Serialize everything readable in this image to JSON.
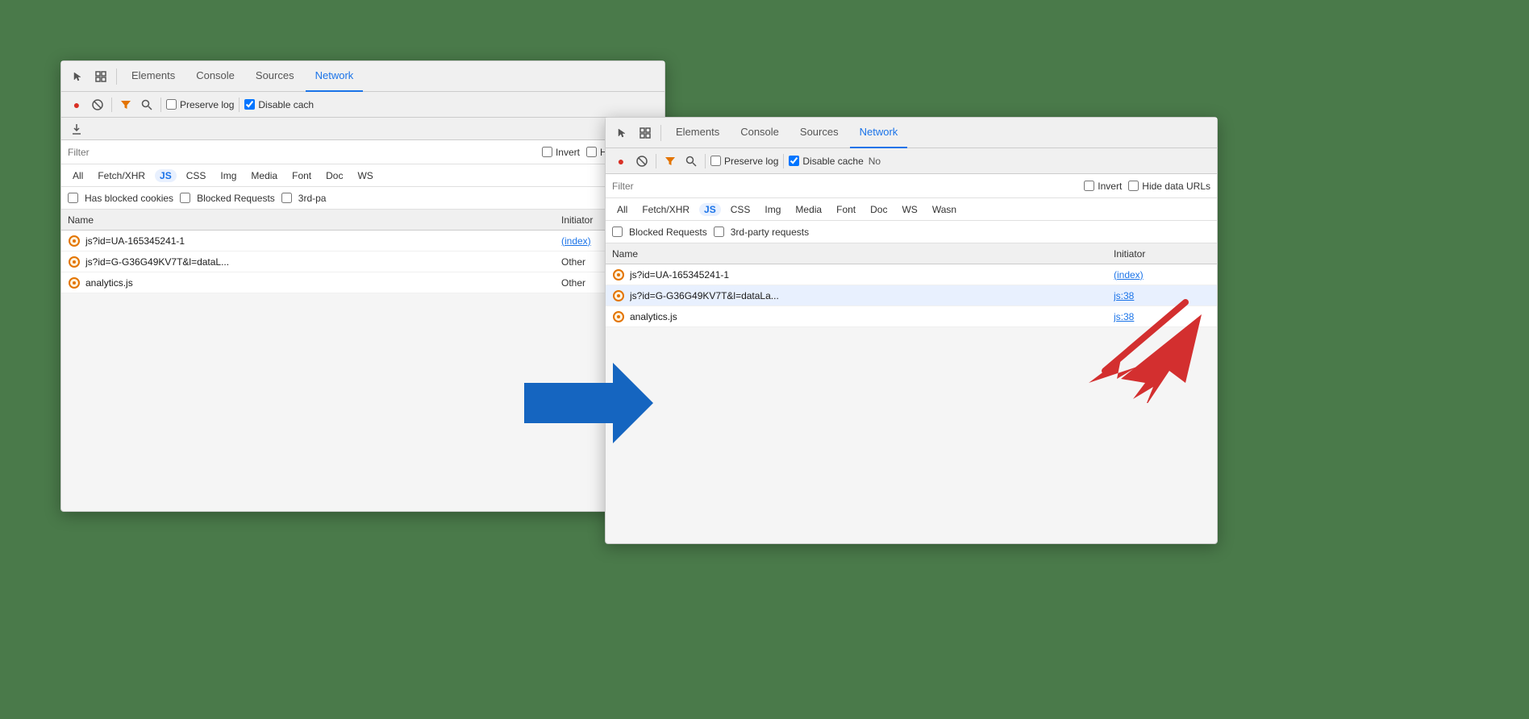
{
  "colors": {
    "background": "#4a7a4a",
    "active_tab": "#1a73e8",
    "record_red": "#d93025",
    "filter_orange": "#e37400",
    "blue_arrow": "#1565c0",
    "red_arrow": "#d32f2f"
  },
  "window1": {
    "tabs": [
      {
        "id": "elements",
        "label": "Elements",
        "active": false
      },
      {
        "id": "console",
        "label": "Console",
        "active": false
      },
      {
        "id": "sources",
        "label": "Sources",
        "active": false
      },
      {
        "id": "network",
        "label": "Network",
        "active": true
      }
    ],
    "toolbar": {
      "preserve_log_label": "Preserve log",
      "disable_cache_label": "Disable cach",
      "disable_cache_checked": true
    },
    "filter": {
      "placeholder": "Filter",
      "invert_label": "Invert",
      "hide_data_label": "Hide data UR"
    },
    "type_filters": [
      "All",
      "Fetch/XHR",
      "JS",
      "CSS",
      "Img",
      "Media",
      "Font",
      "Doc",
      "WS"
    ],
    "active_type": "JS",
    "blocked_row": {
      "has_blocked_label": "Has blocked cookies",
      "blocked_requests_label": "Blocked Requests",
      "third_party_label": "3rd-pa"
    },
    "table": {
      "col_name": "Name",
      "col_initiator": "Initiator",
      "rows": [
        {
          "name": "js?id=UA-165345241-1",
          "initiator": "(index)",
          "initiator_link": true
        },
        {
          "name": "js?id=G-G36G49KV7T&l=dataL...",
          "initiator": "Other",
          "initiator_link": false
        },
        {
          "name": "analytics.js",
          "initiator": "Other",
          "initiator_link": false
        }
      ]
    }
  },
  "window2": {
    "tabs": [
      {
        "id": "elements",
        "label": "Elements",
        "active": false
      },
      {
        "id": "console",
        "label": "Console",
        "active": false
      },
      {
        "id": "sources",
        "label": "Sources",
        "active": false
      },
      {
        "id": "network",
        "label": "Network",
        "active": true
      }
    ],
    "toolbar": {
      "preserve_log_label": "Preserve log",
      "disable_cache_label": "Disable cache",
      "no_label": "No",
      "disable_cache_checked": true
    },
    "filter": {
      "placeholder": "Filter",
      "invert_label": "Invert",
      "hide_data_label": "Hide data URLs"
    },
    "type_filters": [
      "All",
      "Fetch/XHR",
      "JS",
      "CSS",
      "Img",
      "Media",
      "Font",
      "Doc",
      "WS",
      "Wasn"
    ],
    "active_type": "JS",
    "blocked_row": {
      "blocked_requests_label": "Blocked Requests",
      "third_party_label": "3rd-party requests"
    },
    "table": {
      "col_name": "Name",
      "col_initiator": "Initiator",
      "rows": [
        {
          "name": "js?id=UA-165345241-1",
          "initiator": "(index)",
          "initiator_link": true
        },
        {
          "name": "js?id=G-G36G49KV7T&l=dataLa...",
          "initiator": "js:38",
          "initiator_link": true,
          "highlighted": true
        },
        {
          "name": "analytics.js",
          "initiator": "js:38",
          "initiator_link": true
        }
      ]
    }
  }
}
